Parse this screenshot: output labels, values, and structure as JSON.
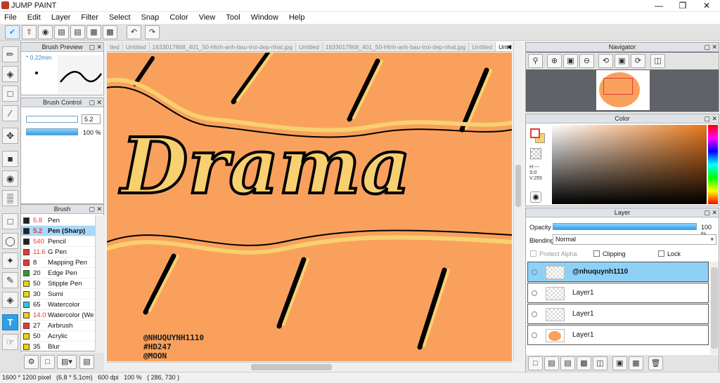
{
  "app": {
    "title": "JUMP PAINT"
  },
  "menu": [
    "File",
    "Edit",
    "Layer",
    "Filter",
    "Select",
    "Snap",
    "Color",
    "View",
    "Tool",
    "Window",
    "Help"
  ],
  "brush_preview": {
    "title": "Brush Preview",
    "size_label": "* 0.22mm"
  },
  "brush_control": {
    "title": "Brush Control",
    "size_value": "5.2",
    "opacity_value": "100 %",
    "size_fraction": 0.55,
    "opacity_fraction": 1.0
  },
  "brush": {
    "title": "Brush",
    "items": [
      {
        "size": "5.8",
        "name": "Pen",
        "color": "#222222",
        "size_red": true
      },
      {
        "size": "5.2",
        "name": "Pen (Sharp)",
        "color": "#222222",
        "size_red": true,
        "selected": true
      },
      {
        "size": "540",
        "name": "Pencil",
        "color": "#222222",
        "size_red": true
      },
      {
        "size": "11.6",
        "name": "G Pen",
        "color": "#e53935",
        "size_red": true
      },
      {
        "size": "8",
        "name": "Mapping Pen",
        "color": "#e53935",
        "size_red": false
      },
      {
        "size": "20",
        "name": "Edge Pen",
        "color": "#2e9c2e",
        "size_red": false
      },
      {
        "size": "50",
        "name": "Stipple Pen",
        "color": "#e6d21a",
        "size_red": false
      },
      {
        "size": "30",
        "name": "Sumi",
        "color": "#e6d21a",
        "size_red": false
      },
      {
        "size": "65",
        "name": "Watercolor",
        "color": "#2ec6d8",
        "size_red": false
      },
      {
        "size": "14.0",
        "name": "Watercolor (We",
        "color": "#e6d21a",
        "size_red": true
      },
      {
        "size": "27",
        "name": "Airbrush",
        "color": "#e53935",
        "size_red": false
      },
      {
        "size": "50",
        "name": "Acrylic",
        "color": "#e6d21a",
        "size_red": false
      },
      {
        "size": "35",
        "name": "Blur",
        "color": "#e6d21a",
        "size_red": false
      }
    ]
  },
  "tabs": [
    "tled",
    "Untitled",
    "1633017868_401_50-Hinh-anh-bau-troi-dep-nhat.jpg",
    "Untitled",
    "1633017868_401_50-Hinh-anh-bau-troi-dep-nhat.jpg",
    "Untitled",
    "Untitled"
  ],
  "canvas": {
    "text_lines": [
      "@NHUQUYNH1110",
      "#HD247",
      "@MOON"
    ],
    "background": "#f9a15c"
  },
  "navigator": {
    "title": "Navigator"
  },
  "color_panel": {
    "title": "Color",
    "h": "H:---",
    "s": "S:0",
    "v": "V:255"
  },
  "layer_panel": {
    "title": "Layer",
    "opacity_label": "Opacity",
    "opacity_value": "100 %",
    "opacity_fraction": 1.0,
    "blending_label": "Blending",
    "blending_value": "Normal",
    "protect_alpha": "Protect Alpha",
    "clipping": "Clipping",
    "lock": "Lock",
    "layers": [
      {
        "name": "@nhuquynh1110",
        "selected": true
      },
      {
        "name": "Layer1",
        "selected": false
      },
      {
        "name": "Layer1",
        "selected": false
      },
      {
        "name": "Layer1",
        "selected": false
      }
    ]
  },
  "status": {
    "text": "1600 * 1200 pixel   (6.8 * 5.1cm)   600 dpi   100 %   ( 286, 730 )"
  }
}
